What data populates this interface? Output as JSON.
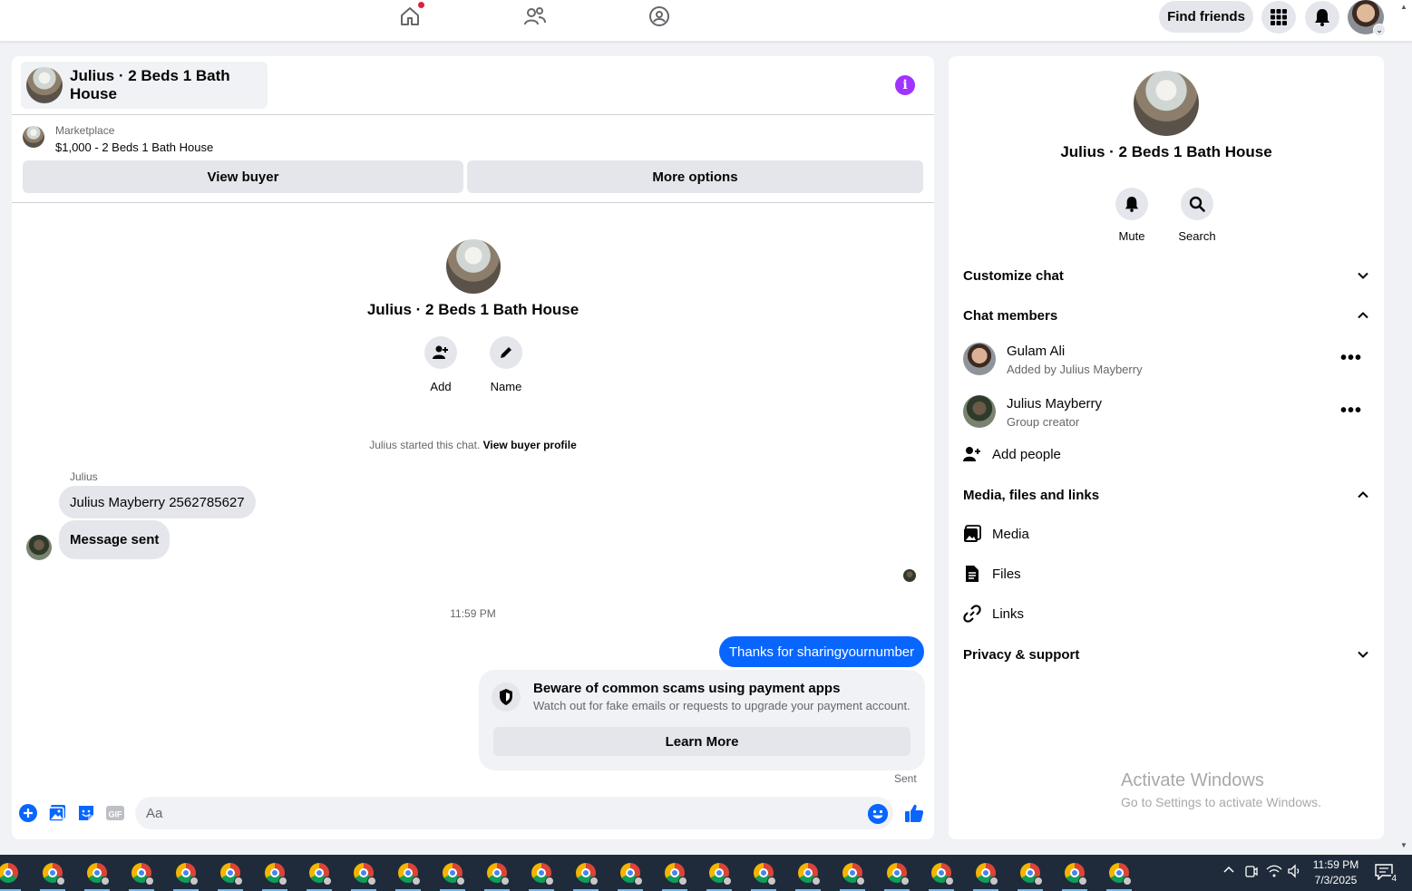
{
  "topnav": {
    "find_friends": "Find friends",
    "icons": [
      "home-icon",
      "friends-icon",
      "groups-icon",
      "menu-grid-icon",
      "bell-icon"
    ]
  },
  "chat": {
    "title": "Julius · 2 Beds 1 Bath House",
    "marketplace_label": "Marketplace",
    "listing": "$1,000 - 2 Beds 1 Bath House",
    "view_buyer": "View buyer",
    "more_options": "More options",
    "add_label": "Add",
    "name_label": "Name",
    "started_text": "Julius started this chat. ",
    "view_buyer_profile": "View buyer profile",
    "sender": "Julius",
    "messages_in": [
      "Julius Mayberry 2562785627",
      "Message sent"
    ],
    "time": "11:59 PM",
    "message_out": "Thanks for sharingyournumber",
    "scam_title": "Beware of common scams using payment apps",
    "scam_desc": "Watch out for fake emails or requests to upgrade your payment account.",
    "learn_more": "Learn More",
    "sent": "Sent",
    "input_placeholder": "Aa"
  },
  "info": {
    "title": "Julius · 2 Beds 1 Bath House",
    "mute": "Mute",
    "search": "Search",
    "customize_chat": "Customize chat",
    "chat_members": "Chat members",
    "members": [
      {
        "name": "Gulam Ali",
        "sub": "Added by Julius Mayberry"
      },
      {
        "name": "Julius Mayberry",
        "sub": "Group creator"
      }
    ],
    "add_people": "Add people",
    "media_section": "Media, files and links",
    "media": "Media",
    "files": "Files",
    "links": "Links",
    "privacy": "Privacy & support"
  },
  "watermark": {
    "line1": "Activate Windows",
    "line2": "Go to Settings to activate Windows."
  },
  "taskbar": {
    "time": "11:59 PM",
    "date": "7/3/2025",
    "notification_count": "4"
  },
  "colors": {
    "accent": "#0866ff",
    "info_purple": "#a033ff",
    "notification_red": "#e41e3f"
  }
}
